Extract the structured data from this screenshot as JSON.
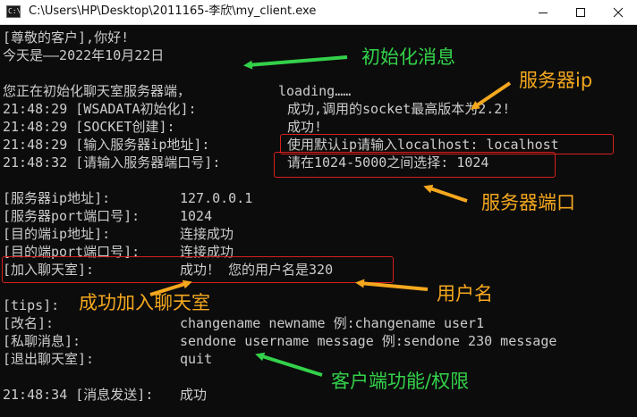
{
  "window": {
    "title": "C:\\Users\\HP\\Desktop\\2011165-李欣\\my_client.exe",
    "icon": "console-icon",
    "controls": [
      "minimize-icon",
      "maximize-icon",
      "close-icon"
    ]
  },
  "console": {
    "greeting": "[尊敬的客户],你好!",
    "today": "今天是——2022年10月22日",
    "init_label": "您正在初始化聊天室服务器端，",
    "init_status": "loading……",
    "log1": {
      "time_tag": "21:48:29 [WSADATA初始化]:",
      "message": "成功,调用的socket最高版本为2.2!"
    },
    "log2": {
      "time_tag": "21:48:29 [SOCKET创建]:",
      "message": "成功!"
    },
    "log3": {
      "time_tag": "21:48:29 [输入服务器ip地址]:",
      "message": "使用默认ip请输入localhost: localhost"
    },
    "log4": {
      "time_tag": "21:48:32 [请输入服务器端口号]:",
      "message": "请在1024-5000之间选择: 1024"
    },
    "info": {
      "server_ip_label": "[服务器ip地址]:",
      "server_ip_value": "127.0.0.1",
      "server_port_label": "[服务器port端口号]:",
      "server_port_value": "1024",
      "dest_ip_label": "[目的端ip地址]:",
      "dest_ip_value": "连接成功",
      "dest_port_label": "[目的端port端口号]:",
      "dest_port_value": "连接成功",
      "join_label": "[加入聊天室]:",
      "join_value": "成功！ 您的用户名是320"
    },
    "tips": {
      "label": "[tips]:",
      "rename_label": "[改名]:",
      "rename_value": "changename newname 例:changename user1",
      "private_label": "[私聊消息]:",
      "private_value": "sendone username message 例:sendone 230 message",
      "quit_label": "[退出聊天室]:",
      "quit_value": "quit"
    },
    "log5": {
      "time_tag": "21:48:34 [消息发送]:",
      "message": "成功"
    }
  },
  "annotations": {
    "init_message": "初始化消息",
    "server_ip": "服务器ip",
    "server_port": "服务器端口",
    "username": "用户名",
    "join_success": "成功加入聊天室",
    "client_functions": "客户端功能/权限"
  },
  "colors": {
    "console_bg": "#0c0c0c",
    "console_text": "#cccccc",
    "annotation_green": "#33d14a",
    "annotation_orange": "#f5a81e",
    "highlight_red": "#d81e1e"
  }
}
